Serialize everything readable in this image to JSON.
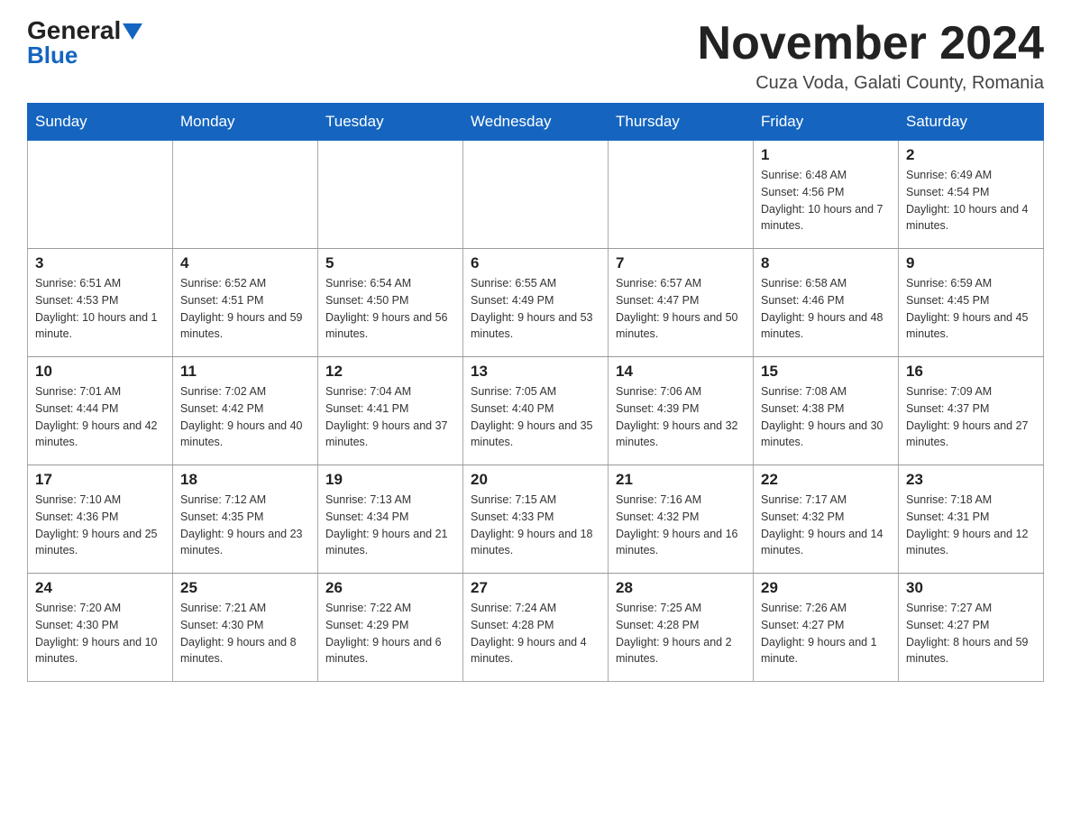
{
  "logo": {
    "text_general": "General",
    "text_blue": "Blue"
  },
  "header": {
    "month_title": "November 2024",
    "location": "Cuza Voda, Galati County, Romania"
  },
  "weekdays": [
    "Sunday",
    "Monday",
    "Tuesday",
    "Wednesday",
    "Thursday",
    "Friday",
    "Saturday"
  ],
  "weeks": [
    [
      {
        "day": "",
        "info": ""
      },
      {
        "day": "",
        "info": ""
      },
      {
        "day": "",
        "info": ""
      },
      {
        "day": "",
        "info": ""
      },
      {
        "day": "",
        "info": ""
      },
      {
        "day": "1",
        "info": "Sunrise: 6:48 AM\nSunset: 4:56 PM\nDaylight: 10 hours and 7 minutes."
      },
      {
        "day": "2",
        "info": "Sunrise: 6:49 AM\nSunset: 4:54 PM\nDaylight: 10 hours and 4 minutes."
      }
    ],
    [
      {
        "day": "3",
        "info": "Sunrise: 6:51 AM\nSunset: 4:53 PM\nDaylight: 10 hours and 1 minute."
      },
      {
        "day": "4",
        "info": "Sunrise: 6:52 AM\nSunset: 4:51 PM\nDaylight: 9 hours and 59 minutes."
      },
      {
        "day": "5",
        "info": "Sunrise: 6:54 AM\nSunset: 4:50 PM\nDaylight: 9 hours and 56 minutes."
      },
      {
        "day": "6",
        "info": "Sunrise: 6:55 AM\nSunset: 4:49 PM\nDaylight: 9 hours and 53 minutes."
      },
      {
        "day": "7",
        "info": "Sunrise: 6:57 AM\nSunset: 4:47 PM\nDaylight: 9 hours and 50 minutes."
      },
      {
        "day": "8",
        "info": "Sunrise: 6:58 AM\nSunset: 4:46 PM\nDaylight: 9 hours and 48 minutes."
      },
      {
        "day": "9",
        "info": "Sunrise: 6:59 AM\nSunset: 4:45 PM\nDaylight: 9 hours and 45 minutes."
      }
    ],
    [
      {
        "day": "10",
        "info": "Sunrise: 7:01 AM\nSunset: 4:44 PM\nDaylight: 9 hours and 42 minutes."
      },
      {
        "day": "11",
        "info": "Sunrise: 7:02 AM\nSunset: 4:42 PM\nDaylight: 9 hours and 40 minutes."
      },
      {
        "day": "12",
        "info": "Sunrise: 7:04 AM\nSunset: 4:41 PM\nDaylight: 9 hours and 37 minutes."
      },
      {
        "day": "13",
        "info": "Sunrise: 7:05 AM\nSunset: 4:40 PM\nDaylight: 9 hours and 35 minutes."
      },
      {
        "day": "14",
        "info": "Sunrise: 7:06 AM\nSunset: 4:39 PM\nDaylight: 9 hours and 32 minutes."
      },
      {
        "day": "15",
        "info": "Sunrise: 7:08 AM\nSunset: 4:38 PM\nDaylight: 9 hours and 30 minutes."
      },
      {
        "day": "16",
        "info": "Sunrise: 7:09 AM\nSunset: 4:37 PM\nDaylight: 9 hours and 27 minutes."
      }
    ],
    [
      {
        "day": "17",
        "info": "Sunrise: 7:10 AM\nSunset: 4:36 PM\nDaylight: 9 hours and 25 minutes."
      },
      {
        "day": "18",
        "info": "Sunrise: 7:12 AM\nSunset: 4:35 PM\nDaylight: 9 hours and 23 minutes."
      },
      {
        "day": "19",
        "info": "Sunrise: 7:13 AM\nSunset: 4:34 PM\nDaylight: 9 hours and 21 minutes."
      },
      {
        "day": "20",
        "info": "Sunrise: 7:15 AM\nSunset: 4:33 PM\nDaylight: 9 hours and 18 minutes."
      },
      {
        "day": "21",
        "info": "Sunrise: 7:16 AM\nSunset: 4:32 PM\nDaylight: 9 hours and 16 minutes."
      },
      {
        "day": "22",
        "info": "Sunrise: 7:17 AM\nSunset: 4:32 PM\nDaylight: 9 hours and 14 minutes."
      },
      {
        "day": "23",
        "info": "Sunrise: 7:18 AM\nSunset: 4:31 PM\nDaylight: 9 hours and 12 minutes."
      }
    ],
    [
      {
        "day": "24",
        "info": "Sunrise: 7:20 AM\nSunset: 4:30 PM\nDaylight: 9 hours and 10 minutes."
      },
      {
        "day": "25",
        "info": "Sunrise: 7:21 AM\nSunset: 4:30 PM\nDaylight: 9 hours and 8 minutes."
      },
      {
        "day": "26",
        "info": "Sunrise: 7:22 AM\nSunset: 4:29 PM\nDaylight: 9 hours and 6 minutes."
      },
      {
        "day": "27",
        "info": "Sunrise: 7:24 AM\nSunset: 4:28 PM\nDaylight: 9 hours and 4 minutes."
      },
      {
        "day": "28",
        "info": "Sunrise: 7:25 AM\nSunset: 4:28 PM\nDaylight: 9 hours and 2 minutes."
      },
      {
        "day": "29",
        "info": "Sunrise: 7:26 AM\nSunset: 4:27 PM\nDaylight: 9 hours and 1 minute."
      },
      {
        "day": "30",
        "info": "Sunrise: 7:27 AM\nSunset: 4:27 PM\nDaylight: 8 hours and 59 minutes."
      }
    ]
  ]
}
